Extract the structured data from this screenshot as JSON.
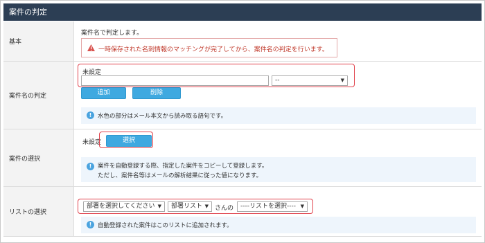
{
  "header": {
    "title": "案件の判定"
  },
  "rows": {
    "basic": {
      "label": "基本",
      "description": "案件名で判定します。",
      "alert": "一時保存された名刺情報のマッチングが完了してから、案件名の判定を行います。"
    },
    "judge": {
      "label": "案件名の判定",
      "status": "未設定",
      "input_value": "",
      "select_value": "--",
      "add_button": "追加",
      "delete_button": "削除",
      "info": "水色の部分はメール本文から読み取る語句です。"
    },
    "select_case": {
      "label": "案件の選択",
      "status": "未設定",
      "select_button": "選択",
      "info_line1": "案件を自動登録する際、指定した案件をコピーして登録します。",
      "info_line2": "ただし、案件名等はメールの解析結果に従った値になります。"
    },
    "list_select": {
      "label": "リストの選択",
      "dept_select": "部署を選択してください",
      "list_select": "部署リスト",
      "san_no": "さんの",
      "list_choose": "----リストを選択----",
      "info": "自動登録された案件はこのリストに追加されます。"
    }
  }
}
